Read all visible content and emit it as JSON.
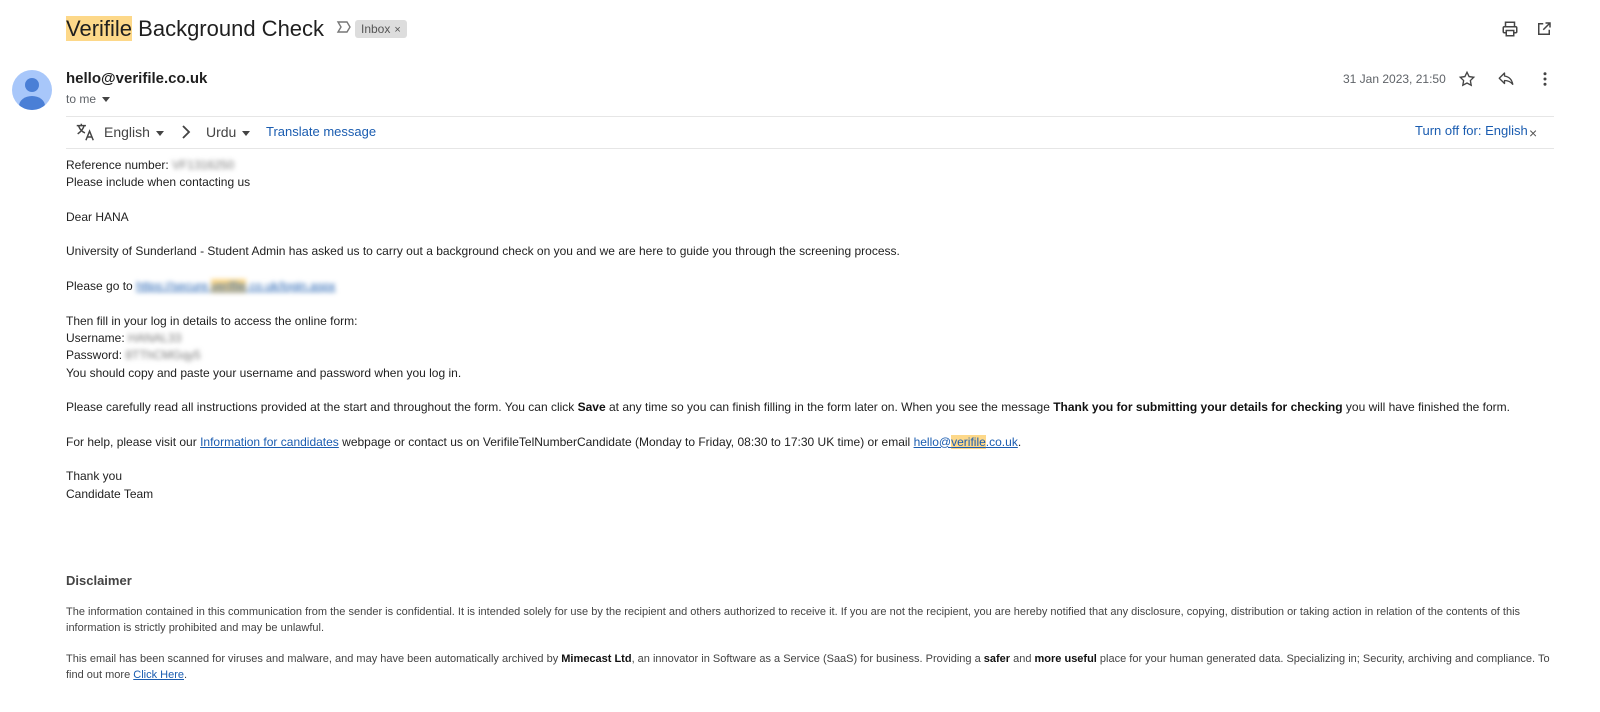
{
  "subject": {
    "highlight": "Verifile",
    "rest": " Background Check",
    "label": "Inbox",
    "label_close": "×"
  },
  "sender": {
    "email": "hello@verifile.co.uk",
    "to": "to me",
    "date": "31 Jan 2023, 21:50"
  },
  "translate": {
    "from_lang": "English",
    "to_lang": "Urdu",
    "translate_link": "Translate message",
    "turn_off": "Turn off for: English",
    "close": "×"
  },
  "body": {
    "ref_label": "Reference number:",
    "ref_value": "VF1316250",
    "ref_note": "Please include when contacting us",
    "greeting": "Dear HANA",
    "intro": "University of Sunderland - Student Admin has asked us to carry out a background check on you and we are here to guide you through the screening process.",
    "goto_label": "Please go to",
    "goto_link_pre": "https://secure.",
    "goto_link_hl": "verifile",
    "goto_link_post": ".co.uk/login.aspx",
    "fill_in": "Then fill in your log in details to access the online form:",
    "username_label": "Username:",
    "username_value": "HANAL33",
    "password_label": "Password:",
    "password_value": "8TThCMGqy5",
    "copy_note": "You should copy and paste your username and password when you log in.",
    "read_pre": "Please carefully read all instructions provided at the start and throughout the form. You can click ",
    "read_save": "Save",
    "read_mid": " at any time so you can finish filling in the form later on. When you see the message ",
    "read_thanks": "Thank you for submitting your details for checking",
    "read_post": " you will have finished the form.",
    "help_pre": "For help, please visit our ",
    "help_link": "Information for candidates",
    "help_mid": " webpage or contact us on VerifileTelNumberCandidate (Monday to Friday, 08:30 to 17:30 UK time) or email ",
    "help_email_pre": "hello@",
    "help_email_hl": "verifile",
    "help_email_post": ".co.uk",
    "help_end": ".",
    "thanks": "Thank you",
    "team": "Candidate Team"
  },
  "disclaimer": {
    "title": "Disclaimer",
    "p1": "The information contained in this communication from the sender is confidential. It is intended solely for use by the recipient and others authorized to receive it. If you are not the recipient, you are hereby notified that any disclosure, copying, distribution or taking action in relation of the contents of this information is strictly prohibited and may be unlawful.",
    "p2_pre": "This email has been scanned for viruses and malware, and may have been automatically archived by ",
    "p2_mimecast": "Mimecast Ltd",
    "p2_mid1": ", an innovator in Software as a Service (SaaS) for business. Providing a ",
    "p2_safer": "safer",
    "p2_and": " and ",
    "p2_useful": "more useful",
    "p2_mid2": " place for your human generated data. Specializing in; Security, archiving and compliance. To find out more ",
    "p2_link": "Click Here",
    "p2_end": "."
  },
  "icons": {
    "importance": "importance-marker-icon",
    "print": "print-icon",
    "popout": "open-in-new-window-icon",
    "star": "star-icon",
    "reply": "reply-icon",
    "more": "more-vertical-icon",
    "translate": "translate-icon",
    "arrow": "chevron-right-icon"
  }
}
